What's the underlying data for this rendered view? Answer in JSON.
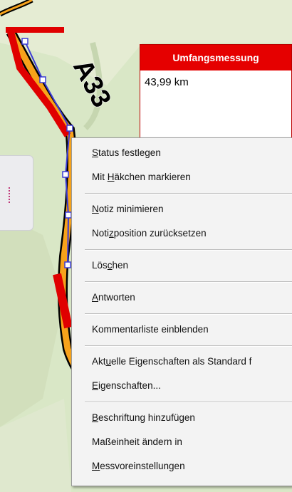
{
  "map": {
    "road_label": "A33",
    "colors": {
      "background": "#d9e7c6",
      "road_orange": "#f7a21b",
      "road_red": "#e00000",
      "measure_blue": "#3b3bd6",
      "accent_red": "#e50000"
    }
  },
  "measurement_note": {
    "title": "Umfangsmessung",
    "value": "43,99 km"
  },
  "context_menu": {
    "groups": [
      {
        "items": [
          {
            "label": "Status festlegen",
            "mnemonic": "S"
          },
          {
            "label": "Mit Häkchen markieren",
            "mnemonic": "H"
          }
        ]
      },
      {
        "items": [
          {
            "label": "Notiz minimieren",
            "mnemonic": "N"
          },
          {
            "label": "Notizposition zurücksetzen",
            "mnemonic": "z"
          }
        ]
      },
      {
        "items": [
          {
            "label": "Löschen",
            "mnemonic": "c"
          }
        ]
      },
      {
        "items": [
          {
            "label": "Antworten",
            "mnemonic": "A"
          }
        ]
      },
      {
        "items": [
          {
            "label": "Kommentarliste einblenden",
            "mnemonic": ""
          }
        ]
      },
      {
        "items": [
          {
            "label": "Aktuelle Eigenschaften als Standard f",
            "mnemonic": "u"
          },
          {
            "label": "Eigenschaften...",
            "mnemonic": "E"
          }
        ]
      },
      {
        "items": [
          {
            "label": "Beschriftung hinzufügen",
            "mnemonic": "B"
          },
          {
            "label": "Maßeinheit ändern in",
            "mnemonic": ""
          },
          {
            "label": "Messvoreinstellungen",
            "mnemonic": "M"
          }
        ]
      }
    ]
  }
}
